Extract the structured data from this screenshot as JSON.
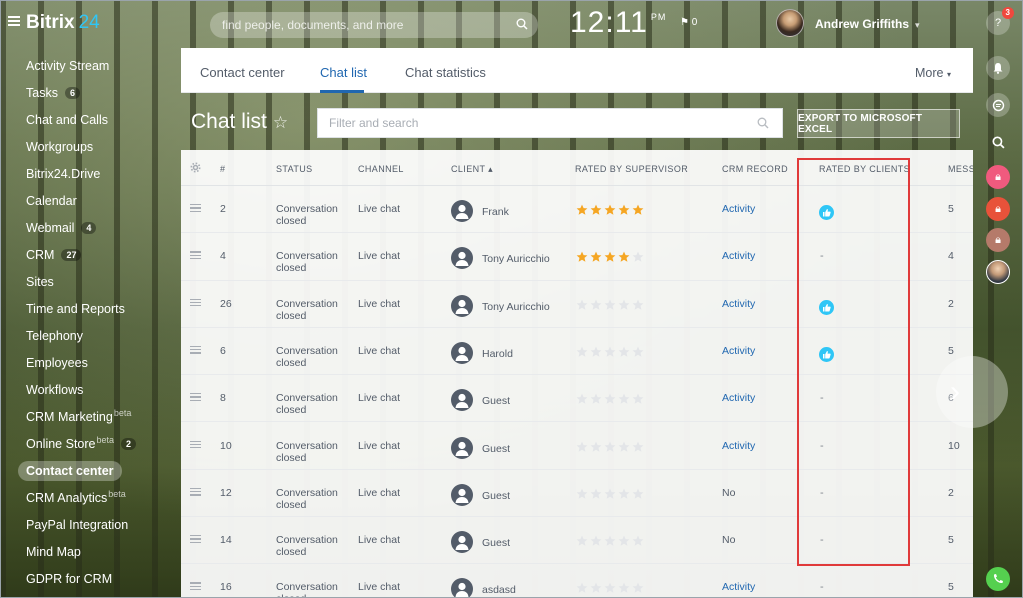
{
  "topbar": {
    "logo_text": "Bitrix",
    "logo_num": "24",
    "search_placeholder": "find people, documents, and more",
    "time": "12:11",
    "ampm": "PM",
    "flag_count": "0",
    "user_name": "Andrew Griffiths"
  },
  "sidebar": {
    "items": [
      {
        "label": "Activity Stream"
      },
      {
        "label": "Tasks",
        "badge": "6"
      },
      {
        "label": "Chat and Calls"
      },
      {
        "label": "Workgroups"
      },
      {
        "label": "Bitrix24.Drive"
      },
      {
        "label": "Calendar"
      },
      {
        "label": "Webmail",
        "badge": "4"
      },
      {
        "label": "CRM",
        "badge": "27"
      },
      {
        "label": "Sites"
      },
      {
        "label": "Time and Reports"
      },
      {
        "label": "Telephony"
      },
      {
        "label": "Employees"
      },
      {
        "label": "Workflows"
      },
      {
        "label": "CRM Marketing",
        "sup": "beta"
      },
      {
        "label": "Online Store",
        "sup": "beta",
        "badge": "2"
      },
      {
        "label": "Contact center",
        "active": true
      },
      {
        "label": "CRM Analytics",
        "sup": "beta"
      },
      {
        "label": "PayPal Integration"
      },
      {
        "label": "Mind Map"
      },
      {
        "label": "GDPR for CRM"
      }
    ]
  },
  "rightbar": {
    "help_count": "3"
  },
  "tabs": {
    "contact_center": "Contact center",
    "chat_list": "Chat list",
    "chat_statistics": "Chat statistics",
    "more": "More"
  },
  "page": {
    "title": "Chat list",
    "filter_placeholder": "Filter and search",
    "export_label": "EXPORT TO MICROSOFT EXCEL"
  },
  "table": {
    "headers": {
      "num": "#",
      "status": "STATUS",
      "channel": "CHANNEL",
      "client": "CLIENT",
      "rated_supervisor": "RATED BY SUPERVISOR",
      "crm_record": "CRM RECORD",
      "rated_clients": "RATED BY CLIENTS",
      "messages": "MESSA"
    },
    "rows": [
      {
        "num": "2",
        "status1": "Conversation",
        "status2": "closed",
        "channel": "Live chat",
        "client": "Frank",
        "rating": 5,
        "crm": "Activity",
        "crm_link": true,
        "liked": true,
        "messages": "5"
      },
      {
        "num": "4",
        "status1": "Conversation",
        "status2": "closed",
        "channel": "Live chat",
        "client": "Tony Auricchio",
        "rating": 4,
        "crm": "Activity",
        "crm_link": true,
        "liked": false,
        "dash": "-",
        "messages": "4"
      },
      {
        "num": "26",
        "status1": "Conversation",
        "status2": "closed",
        "channel": "Live chat",
        "client": "Tony Auricchio",
        "rating": 0,
        "crm": "Activity",
        "crm_link": true,
        "liked": true,
        "messages": "2"
      },
      {
        "num": "6",
        "status1": "Conversation",
        "status2": "closed",
        "channel": "Live chat",
        "client": "Harold",
        "rating": 0,
        "crm": "Activity",
        "crm_link": true,
        "liked": true,
        "messages": "5"
      },
      {
        "num": "8",
        "status1": "Conversation",
        "status2": "closed",
        "channel": "Live chat",
        "client": "Guest",
        "rating": 0,
        "crm": "Activity",
        "crm_link": true,
        "liked": false,
        "dash": "-",
        "messages": "6"
      },
      {
        "num": "10",
        "status1": "Conversation",
        "status2": "closed",
        "channel": "Live chat",
        "client": "Guest",
        "rating": 0,
        "crm": "Activity",
        "crm_link": true,
        "liked": false,
        "dash": "-",
        "messages": "10"
      },
      {
        "num": "12",
        "status1": "Conversation",
        "status2": "closed",
        "channel": "Live chat",
        "client": "Guest",
        "rating": 0,
        "crm": "No",
        "crm_link": false,
        "liked": false,
        "dash": "-",
        "messages": "2"
      },
      {
        "num": "14",
        "status1": "Conversation",
        "status2": "closed",
        "channel": "Live chat",
        "client": "Guest",
        "rating": 0,
        "crm": "No",
        "crm_link": false,
        "liked": false,
        "dash": "-",
        "messages": "5"
      },
      {
        "num": "16",
        "status1": "Conversation",
        "status2": "closed",
        "channel": "Live chat",
        "client": "asdasd",
        "rating": 0,
        "crm": "Activity",
        "crm_link": true,
        "liked": false,
        "dash": "-",
        "messages": "5"
      }
    ]
  },
  "colors": {
    "accent": "#2067b0",
    "star_on": "#f5a623",
    "star_off": "#e3e5e8",
    "like": "#2fc6f6",
    "highlight": "#e03a3a"
  }
}
